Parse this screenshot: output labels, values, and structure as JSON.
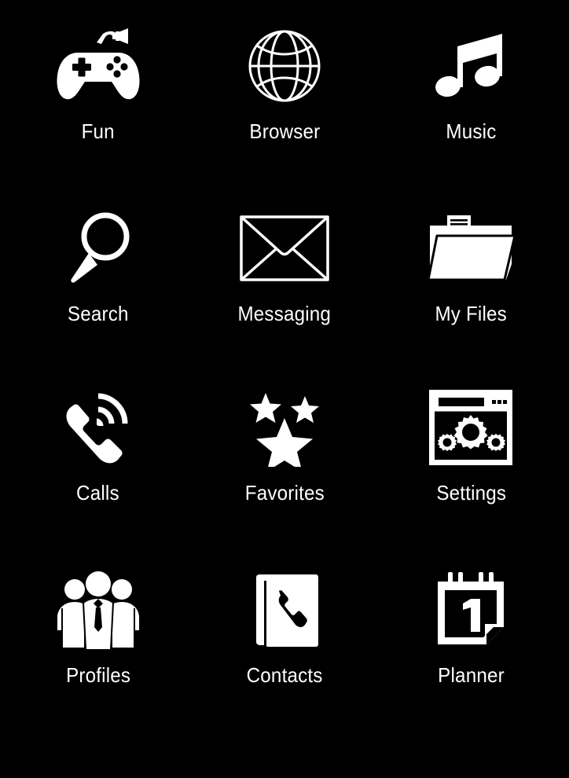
{
  "screen": {
    "background_color": "#000000",
    "foreground_color": "#ffffff",
    "columns": 3,
    "rows": 4
  },
  "apps": [
    {
      "label": "Fun",
      "icon": "gamepad-icon"
    },
    {
      "label": "Browser",
      "icon": "globe-icon"
    },
    {
      "label": "Music",
      "icon": "music-note-icon"
    },
    {
      "label": "Search",
      "icon": "magnifier-icon"
    },
    {
      "label": "Messaging",
      "icon": "envelope-icon"
    },
    {
      "label": "My Files",
      "icon": "folder-icon"
    },
    {
      "label": "Calls",
      "icon": "phone-ringing-icon"
    },
    {
      "label": "Favorites",
      "icon": "stars-icon"
    },
    {
      "label": "Settings",
      "icon": "window-gears-icon"
    },
    {
      "label": "Profiles",
      "icon": "people-group-icon"
    },
    {
      "label": "Contacts",
      "icon": "phone-book-icon"
    },
    {
      "label": "Planner",
      "icon": "calendar-one-icon"
    }
  ]
}
